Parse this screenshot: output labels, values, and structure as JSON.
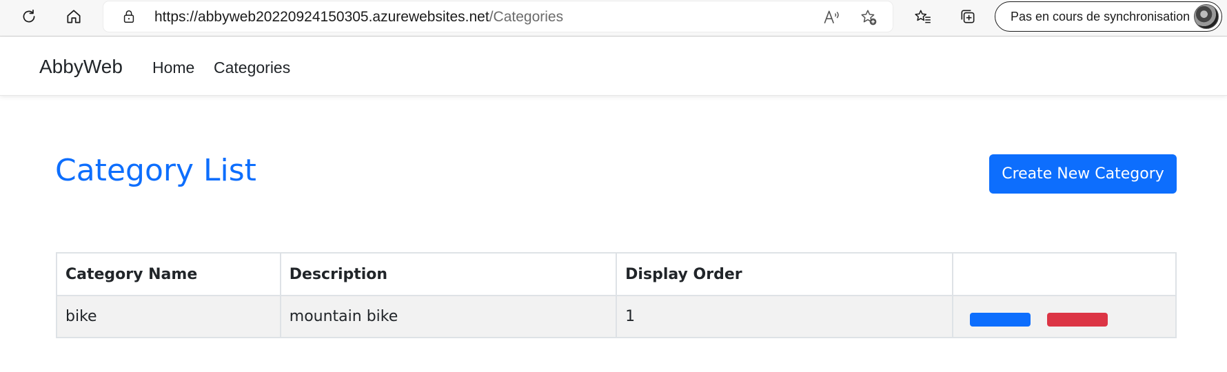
{
  "browser": {
    "url_main": "https://abbyweb20220924150305.azurewebsites.net",
    "url_path": "/Categories",
    "sync_label": "Pas en cours de synchronisation",
    "icons": [
      "refresh-icon",
      "home-icon",
      "lock-icon",
      "read-aloud-icon",
      "add-favorite-icon",
      "favorites-icon",
      "collections-icon"
    ]
  },
  "navbar": {
    "brand": "AbbyWeb",
    "links": [
      {
        "label": "Home"
      },
      {
        "label": "Categories"
      }
    ]
  },
  "main": {
    "title": "Category List",
    "create_button": "Create New Category"
  },
  "table": {
    "headers": [
      "Category Name",
      "Description",
      "Display Order",
      ""
    ],
    "rows": [
      {
        "name": "bike",
        "description": "mountain bike",
        "display_order": "1"
      }
    ]
  },
  "colors": {
    "primary": "#0d6efd",
    "danger": "#dc3545",
    "row_bg": "#f2f2f2"
  }
}
